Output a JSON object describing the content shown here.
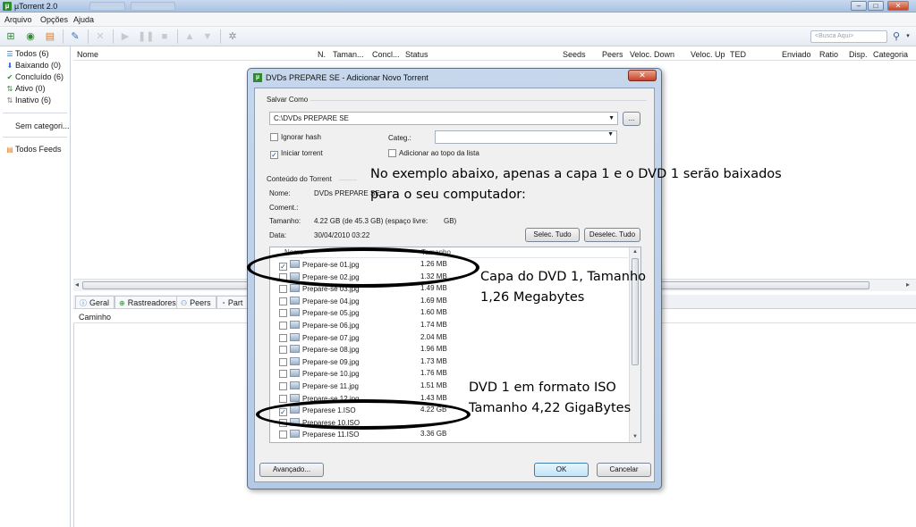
{
  "window": {
    "title": "µTorrent 2.0",
    "controls": [
      "–",
      "□",
      "✕"
    ]
  },
  "menu": [
    "Arquivo",
    "Opções",
    "Ajuda"
  ],
  "toolbar": {
    "search_placeholder": "<Busca Aqui>"
  },
  "sidebar": {
    "items": [
      {
        "label": "Todos (6)",
        "icon": "list-icon"
      },
      {
        "label": "Baixando (0)",
        "icon": "download-arrow-icon"
      },
      {
        "label": "Concluído (6)",
        "icon": "checkmark-icon"
      },
      {
        "label": "Ativo (0)",
        "icon": "active-arrows-icon"
      },
      {
        "label": "Inativo (6)",
        "icon": "inactive-arrows-icon"
      }
    ],
    "uncategorized": "Sem categori...",
    "feeds": "Todos Feeds"
  },
  "columns": [
    "Nome",
    "N.",
    "Taman...",
    "Concl...",
    "Status",
    "Seeds",
    "Peers",
    "Veloc. Down",
    "Veloc. Up",
    "TED",
    "Enviado",
    "Ratio",
    "Disp.",
    "Categoria"
  ],
  "detail_tabs": [
    "Geral",
    "Rastreadores",
    "Peers",
    "Part"
  ],
  "detail_header": "Caminho",
  "dialog": {
    "title": "DVDs PREPARE SE - Adicionar Novo Torrent",
    "close": "✕",
    "save_as_label": "Salvar Como",
    "save_path": "C:\\DVDs PREPARE SE",
    "browse_button": "...",
    "ignore_hash": "Ignorar hash",
    "ignore_hash_checked": false,
    "start_torrent": "Iniciar torrent",
    "start_torrent_checked": true,
    "category_label": "Categ.:",
    "category_value": "",
    "add_top": "Adicionar ao topo da lista",
    "add_top_checked": false,
    "content_label": "Conteúdo do Torrent",
    "name_label": "Nome:",
    "name_value": "DVDs PREPARE SE",
    "comment_label": "Coment.:",
    "size_label": "Tamanho:",
    "size_value": "4.22 GB (de 45.3 GB) (espaço livre:",
    "size_unit": "GB)",
    "date_label": "Data:",
    "date_value": "30/04/2010 03:22",
    "select_all": "Selec. Tudo",
    "deselect_all": "Deselec. Tudo",
    "list_headers": [
      "Nome",
      "Tamanho"
    ],
    "files": [
      {
        "name": "Prepare-se 01.jpg",
        "size": "1.26 MB",
        "checked": true
      },
      {
        "name": "Prepare-se 02.jpg",
        "size": "1.32 MB",
        "checked": false
      },
      {
        "name": "Prepare-se 03.jpg",
        "size": "1.49 MB",
        "checked": false
      },
      {
        "name": "Prepare-se 04.jpg",
        "size": "1.69 MB",
        "checked": false
      },
      {
        "name": "Prepare-se 05.jpg",
        "size": "1.60 MB",
        "checked": false
      },
      {
        "name": "Prepare-se 06.jpg",
        "size": "1.74 MB",
        "checked": false
      },
      {
        "name": "Prepare-se 07.jpg",
        "size": "2.04 MB",
        "checked": false
      },
      {
        "name": "Prepare-se 08.jpg",
        "size": "1.96 MB",
        "checked": false
      },
      {
        "name": "Prepare-se 09.jpg",
        "size": "1.73 MB",
        "checked": false
      },
      {
        "name": "Prepare-se 10.jpg",
        "size": "1.76 MB",
        "checked": false
      },
      {
        "name": "Prepare-se 11.jpg",
        "size": "1.51 MB",
        "checked": false
      },
      {
        "name": "Prepare-se 12.jpg",
        "size": "1.43 MB",
        "checked": false
      },
      {
        "name": "Preparese 1.ISO",
        "size": "4.22 GB",
        "checked": true
      },
      {
        "name": "Preparese 10.ISO",
        "size": "",
        "checked": false
      },
      {
        "name": "Preparese 11.ISO",
        "size": "3.36 GB",
        "checked": false
      }
    ],
    "advanced_button": "Avançado...",
    "ok_button": "OK",
    "cancel_button": "Cancelar"
  },
  "annotations": {
    "intro_line1": "No exemplo abaixo, apenas a capa 1 e o DVD 1 serão baixados",
    "intro_line2": "para o seu computador:",
    "cover_line1": "Capa do DVD 1, Tamanho",
    "cover_line2": "1,26 Megabytes",
    "iso_line1": "DVD 1 em formato ISO",
    "iso_line2": "Tamanho 4,22 GigaBytes"
  }
}
